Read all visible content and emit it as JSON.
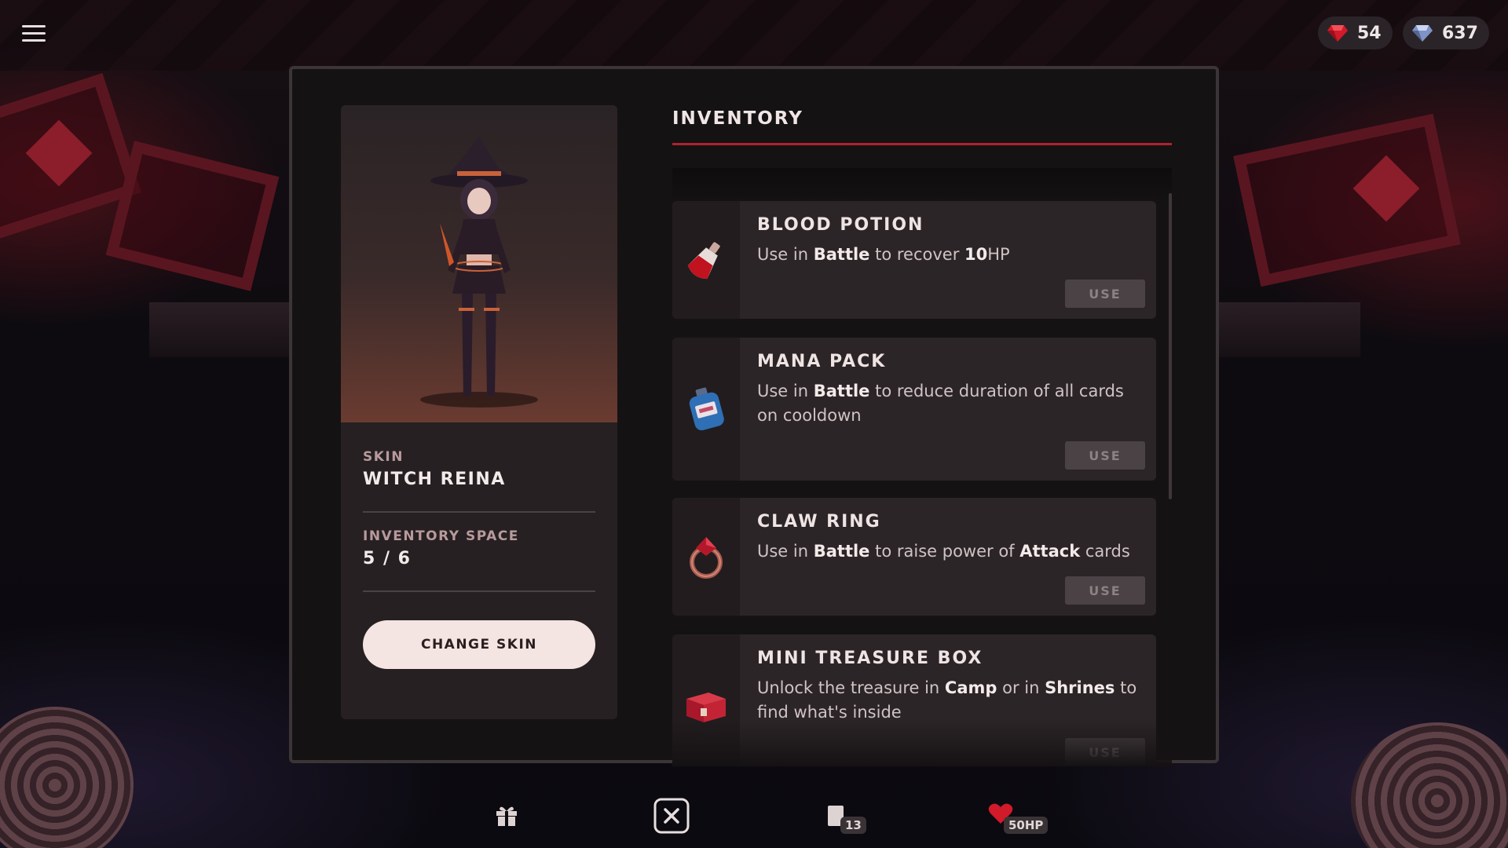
{
  "currencies": [
    {
      "icon": "ruby-icon",
      "value": "54",
      "color": "#d11a2a"
    },
    {
      "icon": "diamond-icon",
      "value": "637",
      "color": "#8fa6d8"
    }
  ],
  "character": {
    "skin_label": "SKIN",
    "skin_name": "WITCH REINA",
    "space_label": "INVENTORY SPACE",
    "space_value": "5 / 6",
    "change_skin_label": "CHANGE SKIN"
  },
  "inventory": {
    "title": "INVENTORY",
    "use_label": "USE",
    "items": [
      {
        "name": "BLOOD POTION",
        "icon": "blood-potion-icon",
        "desc": [
          "Use in ",
          {
            "b": "Battle"
          },
          " to recover ",
          {
            "b": "10"
          },
          "HP"
        ]
      },
      {
        "name": "MANA PACK",
        "icon": "mana-pack-icon",
        "desc": [
          "Use in ",
          {
            "b": "Battle"
          },
          " to reduce duration of all cards on cooldown"
        ]
      },
      {
        "name": "CLAW RING",
        "icon": "claw-ring-icon",
        "desc": [
          "Use in ",
          {
            "b": "Battle"
          },
          " to raise power of ",
          {
            "b": "Attack"
          },
          " cards"
        ]
      },
      {
        "name": "MINI TREASURE BOX",
        "icon": "treasure-box-icon",
        "desc": [
          "Unlock the treasure in ",
          {
            "b": "Camp"
          },
          " or in ",
          {
            "b": "Shrines"
          },
          " to find what's inside"
        ]
      }
    ]
  },
  "bottom_bar": {
    "gift_icon": "gift-icon",
    "close_icon": "close-icon",
    "cards_count": "13",
    "hp_value": "50HP"
  },
  "colors": {
    "accent_red": "#b0212f",
    "panel_bg": "#151213",
    "card_bg": "#2c2527"
  }
}
